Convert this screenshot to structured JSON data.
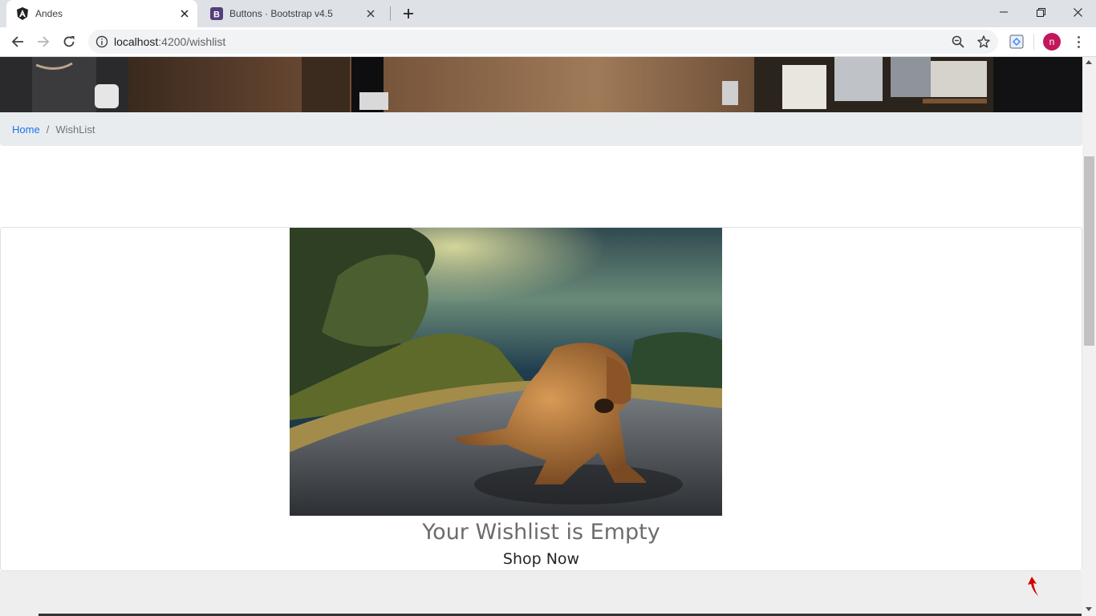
{
  "browser": {
    "tabs": [
      {
        "title": "Andes",
        "favicon": "angular-icon",
        "active": true
      },
      {
        "title": "Buttons · Bootstrap v4.5",
        "favicon": "bootstrap-icon",
        "active": false
      }
    ],
    "url_host": "localhost",
    "url_rest": ":4200/wishlist",
    "profile_initial": "n",
    "colors": {
      "tabstrip": "#dee1e6",
      "avatar": "#c2185b",
      "link": "#1a73e8"
    }
  },
  "page": {
    "breadcrumb": {
      "home": "Home",
      "separator": "/",
      "current": "WishList"
    },
    "empty_state": {
      "title": "Your Wishlist is Empty",
      "cta": "Shop Now"
    }
  }
}
